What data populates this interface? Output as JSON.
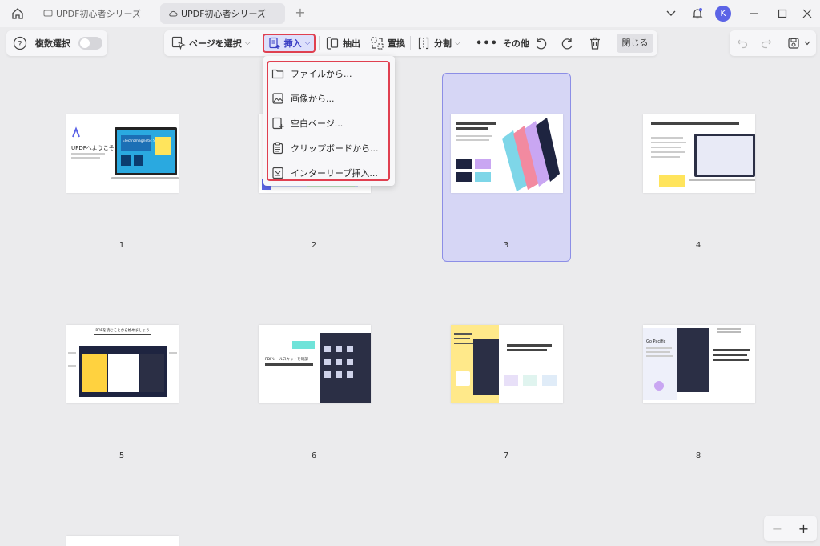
{
  "tabs": [
    {
      "label": "UPDF初心者シリーズ",
      "icon": "chat-icon"
    },
    {
      "label": "UPDF初心者シリーズ",
      "icon": "cloud-icon"
    }
  ],
  "avatar_letter": "K",
  "multi_select_label": "複数選択",
  "toolbar": {
    "select_page": "ページを選択",
    "insert": "挿入",
    "extract": "抽出",
    "replace": "置換",
    "split": "分割",
    "more": "その他",
    "close": "閉じる"
  },
  "insert_menu": [
    {
      "label": "ファイルから...",
      "icon": "folder-icon"
    },
    {
      "label": "画像から...",
      "icon": "image-icon"
    },
    {
      "label": "空白ページ...",
      "icon": "blank-page-icon"
    },
    {
      "label": "クリップボードから...",
      "icon": "clipboard-icon"
    },
    {
      "label": "インターリーブ挿入...",
      "icon": "interleave-icon"
    }
  ],
  "pages": [
    "1",
    "2",
    "3",
    "4",
    "5",
    "6",
    "7",
    "8"
  ],
  "thumb_text": {
    "p1_title": "UPDFへようこそ",
    "p1_card": "Electromagnetic Spectrum",
    "p5_title": "PDFを読むことから始めましょう",
    "p6_title": "PDFツールスキットを確認",
    "p8_title": "Go Pacific"
  },
  "colors": {
    "accent": "#5c64e6",
    "highlight_border": "#e04050",
    "selected_fill": "#d6d6f5"
  }
}
